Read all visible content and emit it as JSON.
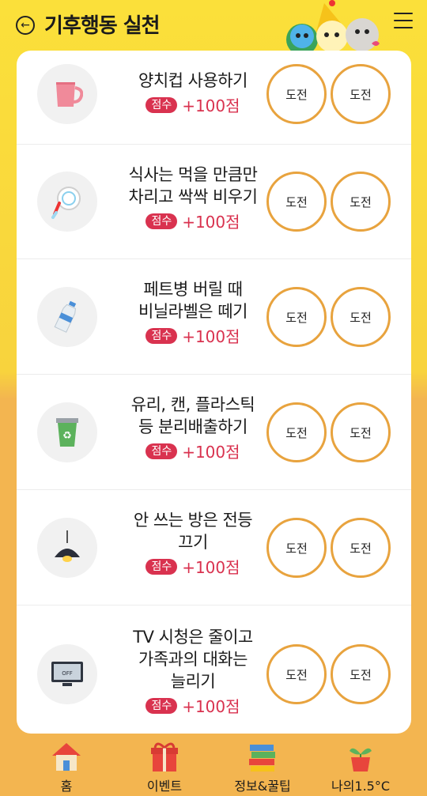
{
  "header": {
    "title": "기후행동 실천"
  },
  "tasks": [
    {
      "icon": "cup-icon",
      "title": "양치컵 사용하기",
      "badge": "점수",
      "score": "+100점",
      "btn1": "도전",
      "btn2": "도전"
    },
    {
      "icon": "clean-plate-icon",
      "title": "식사는 먹을 만큼만\n차리고 싹싹 비우기",
      "badge": "점수",
      "score": "+100점",
      "btn1": "도전",
      "btn2": "도전"
    },
    {
      "icon": "plastic-bottle-icon",
      "title": "페트병 버릴 때\n비닐라벨은 떼기",
      "badge": "점수",
      "score": "+100점",
      "btn1": "도전",
      "btn2": "도전"
    },
    {
      "icon": "recycle-bin-icon",
      "title": "유리, 캔, 플라스틱\n등 분리배출하기",
      "badge": "점수",
      "score": "+100점",
      "btn1": "도전",
      "btn2": "도전"
    },
    {
      "icon": "ceiling-lamp-icon",
      "title": "안 쓰는 방은 전등\n끄기",
      "badge": "점수",
      "score": "+100점",
      "btn1": "도전",
      "btn2": "도전"
    },
    {
      "icon": "tv-off-icon",
      "title": "TV 시청은 줄이고\n가족과의 대화는\n늘리기",
      "badge": "점수",
      "score": "+100점",
      "btn1": "도전",
      "btn2": "도전"
    }
  ],
  "tv_screen_text": "OFF",
  "nav": [
    {
      "icon": "home-icon",
      "label": "홈"
    },
    {
      "icon": "gift-icon",
      "label": "이벤트"
    },
    {
      "icon": "books-icon",
      "label": "정보&꿀팁"
    },
    {
      "icon": "sprout-icon",
      "label": "나의1.5°C"
    }
  ],
  "colors": {
    "accent": "#d9324f",
    "button_ring": "#e8a33e",
    "top_bg": "#fbe03a",
    "bottom_bg": "#f3b550"
  }
}
